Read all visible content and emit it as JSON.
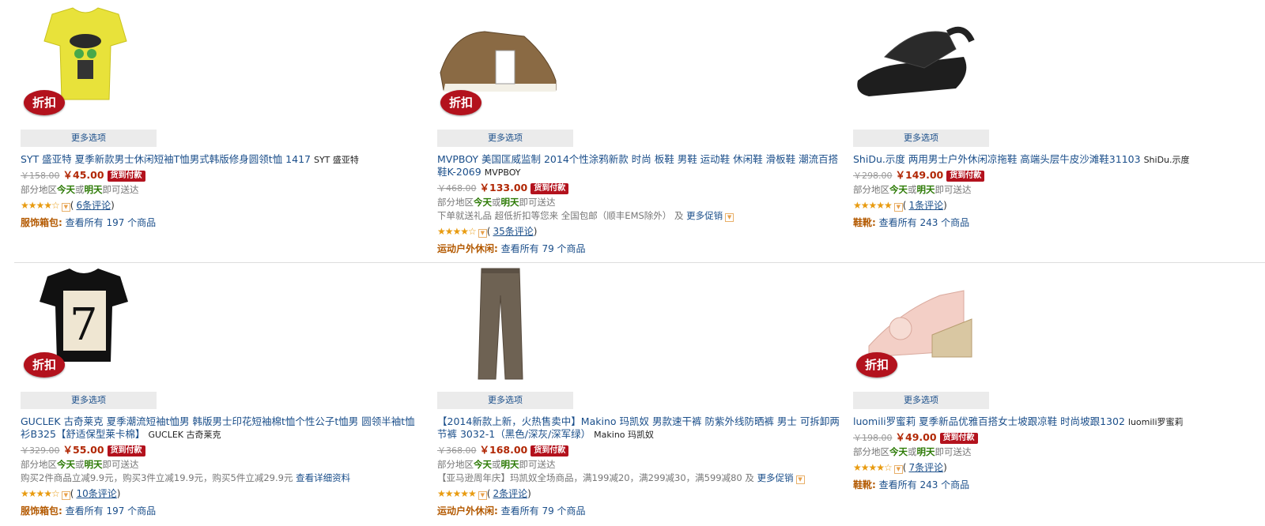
{
  "colors": {
    "link": "#1a4e8a",
    "price": "#b12704",
    "badge": "#b3121d",
    "star": "#e89b10",
    "category": "#b35900",
    "delivery": "#2c7a05"
  },
  "products": [
    {
      "image": "yellow-tshirt-image",
      "discount_badge": "折扣",
      "more_options": "更多选项",
      "title": "SYT 盛亚特 夏季新款男士休闲短袖T恤男式韩版修身圆领t恤 1417",
      "brand": "SYT 盛亚特",
      "old_price": "￥158.00",
      "price": "￥45.00",
      "cod": "货到付款",
      "delivery": {
        "prefix": "部分地区",
        "today": "今天",
        "or": "或",
        "tomorrow": "明天",
        "suffix": "即可送达"
      },
      "promo": null,
      "stars": "★★★★☆",
      "rating": 4,
      "reviews": "6条评论",
      "category_label": "服饰箱包:",
      "category_link": "查看所有 197 个商品"
    },
    {
      "image": "sneaker-image",
      "discount_badge": "折扣",
      "more_options": "更多选项",
      "title": "MVPBOY 美国匡威监制 2014个性涂鸦新款 时尚 板鞋 男鞋 运动鞋 休闲鞋 滑板鞋 潮流百搭鞋K-2069",
      "brand": "MVPBOY",
      "old_price": "￥468.00",
      "price": "￥133.00",
      "cod": "货到付款",
      "delivery": {
        "prefix": "部分地区",
        "today": "今天",
        "or": "或",
        "tomorrow": "明天",
        "suffix": "即可送达"
      },
      "promo": {
        "text": "下单就送礼品 超低折扣等您来 全国包邮（顺丰EMS除外） 及",
        "link": "更多促销"
      },
      "stars": "★★★★☆",
      "rating": 4.5,
      "reviews": "35条评论",
      "category_label": "运动户外休闲:",
      "category_link": "查看所有 79 个商品"
    },
    {
      "image": "sandal-image",
      "discount_badge": "",
      "more_options": "更多选项",
      "title": "ShiDu.示度 两用男士户外休闲凉拖鞋 高端头层牛皮沙滩鞋31103",
      "brand": "ShiDu.示度",
      "old_price": "￥298.00",
      "price": "￥149.00",
      "cod": "货到付款",
      "delivery": {
        "prefix": "部分地区",
        "today": "今天",
        "or": "或",
        "tomorrow": "明天",
        "suffix": "即可送达"
      },
      "promo": null,
      "stars": "★★★★★",
      "rating": 5,
      "reviews": "1条评论",
      "category_label": "鞋靴:",
      "category_link": "查看所有 243 个商品"
    },
    {
      "image": "black-tshirt-image",
      "discount_badge": "折扣",
      "more_options": "更多选项",
      "title": "GUCLEK 古奇莱克 夏季潮流短袖t恤男 韩版男士印花短袖棉t恤个性公子t恤男 圆领半袖t恤衫B325【舒适保型莱卡棉】",
      "brand": "GUCLEK 古奇莱克",
      "old_price": "￥329.00",
      "price": "￥55.00",
      "cod": "货到付款",
      "delivery": {
        "prefix": "部分地区",
        "today": "今天",
        "or": "或",
        "tomorrow": "明天",
        "suffix": "即可送达"
      },
      "promo": {
        "text": "购买2件商品立减9.9元，购买3件立减19.9元，购买5件立减29.9元",
        "link": "查看详细资料"
      },
      "stars": "★★★★☆",
      "rating": 4.5,
      "reviews": "10条评论",
      "category_label": "服饰箱包:",
      "category_link": "查看所有 197 个商品"
    },
    {
      "image": "pants-image",
      "discount_badge": "",
      "more_options": "更多选项",
      "title": "【2014新款上新，火热售卖中】Makino 玛凯奴 男款速干裤 防紫外线防晒裤 男士 可拆卸两节裤 3032-1（黑色/深灰/深军绿）",
      "brand": "Makino 玛凯奴",
      "old_price": "￥368.00",
      "price": "￥168.00",
      "cod": "货到付款",
      "delivery": {
        "prefix": "部分地区",
        "today": "今天",
        "or": "或",
        "tomorrow": "明天",
        "suffix": "即可送达"
      },
      "promo": {
        "text": "【亚马逊周年庆】玛凯奴全场商品，满199减20，满299减30，满599减80 及",
        "link": "更多促销"
      },
      "stars": "★★★★★",
      "rating": 5,
      "reviews": "2条评论",
      "category_label": "运动户外休闲:",
      "category_link": "查看所有 79 个商品"
    },
    {
      "image": "wedge-sandal-image",
      "discount_badge": "折扣",
      "more_options": "更多选项",
      "title": "luomili罗蜜莉 夏季新品优雅百搭女士坡跟凉鞋 时尚坡跟1302",
      "brand": "luomili罗蜜莉",
      "old_price": "￥198.00",
      "price": "￥49.00",
      "cod": "货到付款",
      "delivery": {
        "prefix": "部分地区",
        "today": "今天",
        "or": "或",
        "tomorrow": "明天",
        "suffix": "即可送达"
      },
      "promo": null,
      "stars": "★★★★☆",
      "rating": 4.5,
      "reviews": "7条评论",
      "category_label": "鞋靴:",
      "category_link": "查看所有 243 个商品"
    }
  ]
}
